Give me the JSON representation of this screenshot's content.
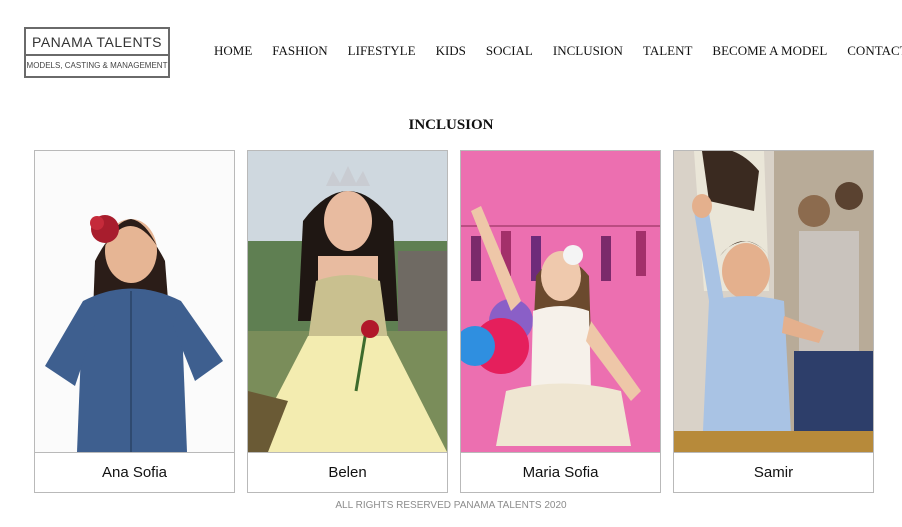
{
  "logo": {
    "name": "PANAMA TALENTS",
    "tagline": "MODELS, CASTING & MANAGEMENT"
  },
  "nav": [
    {
      "label": "HOME"
    },
    {
      "label": "FASHION"
    },
    {
      "label": "LIFESTYLE"
    },
    {
      "label": "KIDS"
    },
    {
      "label": "SOCIAL"
    },
    {
      "label": "INCLUSION"
    },
    {
      "label": "TALENT"
    },
    {
      "label": "BECOME A MODEL"
    },
    {
      "label": "CONTACT"
    }
  ],
  "page": {
    "title": "INCLUSION"
  },
  "talents": [
    {
      "name": "Ana Sofia"
    },
    {
      "name": "Belen"
    },
    {
      "name": "Maria Sofia"
    },
    {
      "name": "Samir"
    }
  ],
  "footer": {
    "text": "ALL RIGHTS RESERVED PANAMA TALENTS 2020"
  }
}
